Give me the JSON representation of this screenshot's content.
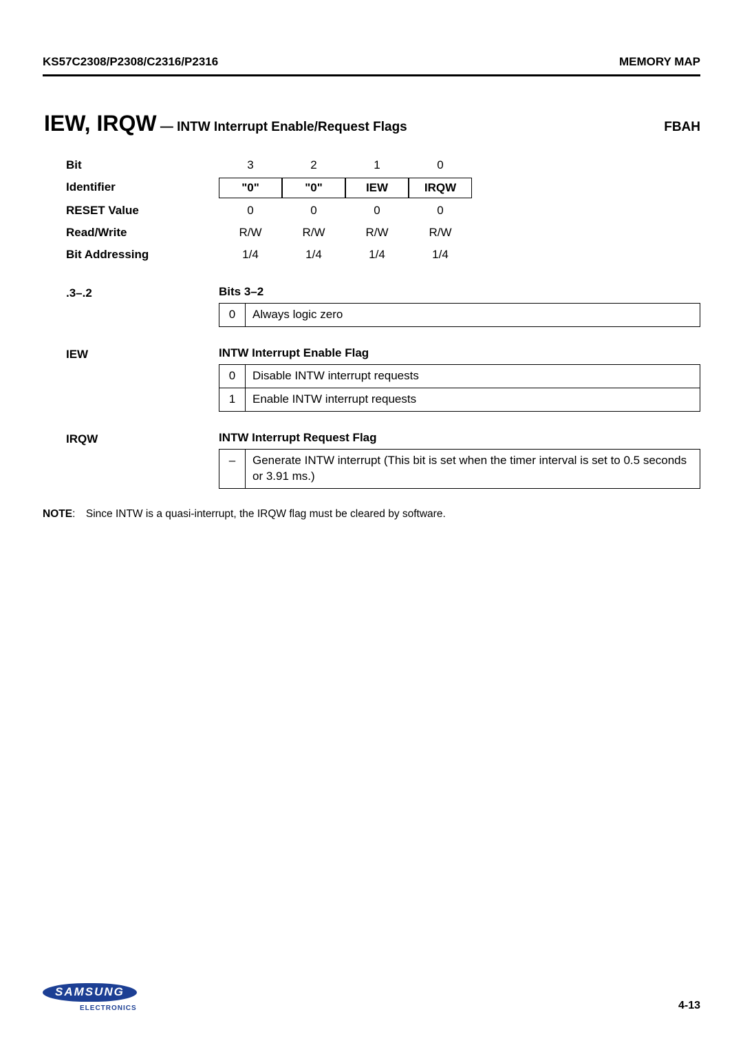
{
  "header": {
    "left": "KS57C2308/P2308/C2316/P2316",
    "right": "MEMORY MAP"
  },
  "title": {
    "main": "IEW, IRQW",
    "sub": " — INTW Interrupt Enable/Request Flags",
    "code": "FBAH"
  },
  "bits": {
    "rows": {
      "bit": {
        "label": "Bit",
        "cells": [
          "3",
          "2",
          "1",
          "0"
        ]
      },
      "identifier": {
        "label": "Identifier",
        "cells": [
          "\"0\"",
          "\"0\"",
          "IEW",
          "IRQW"
        ]
      },
      "reset": {
        "label_small": "RESET",
        "label_rest": " Value",
        "cells": [
          "0",
          "0",
          "0",
          "0"
        ]
      },
      "rw": {
        "label": "Read/Write",
        "cells": [
          "R/W",
          "R/W",
          "R/W",
          "R/W"
        ]
      },
      "addr": {
        "label": "Bit Addressing",
        "cells": [
          "1/4",
          "1/4",
          "1/4",
          "1/4"
        ]
      }
    }
  },
  "sections": {
    "bits32": {
      "label": ".3–.2",
      "head": "Bits 3–2",
      "rows": [
        {
          "code": "0",
          "text": "Always logic zero"
        }
      ]
    },
    "iew": {
      "label": "IEW",
      "head": "INTW Interrupt Enable Flag",
      "rows": [
        {
          "code": "0",
          "text": "Disable INTW interrupt requests"
        },
        {
          "code": "1",
          "text": "Enable INTW interrupt requests"
        }
      ]
    },
    "irqw": {
      "label": "IRQW",
      "head": "INTW Interrupt Request Flag",
      "rows": [
        {
          "code": "–",
          "text": "Generate INTW interrupt (This bit is set when the timer interval is set to 0.5 seconds or 3.91 ms.)"
        }
      ]
    }
  },
  "note": {
    "bold": "NOTE",
    "text": ": Since INTW is a quasi-interrupt, the IRQW flag must be cleared by software."
  },
  "footer": {
    "logo_main": "SAMSUNG",
    "logo_sub": "ELECTRONICS",
    "page": "4-13"
  }
}
